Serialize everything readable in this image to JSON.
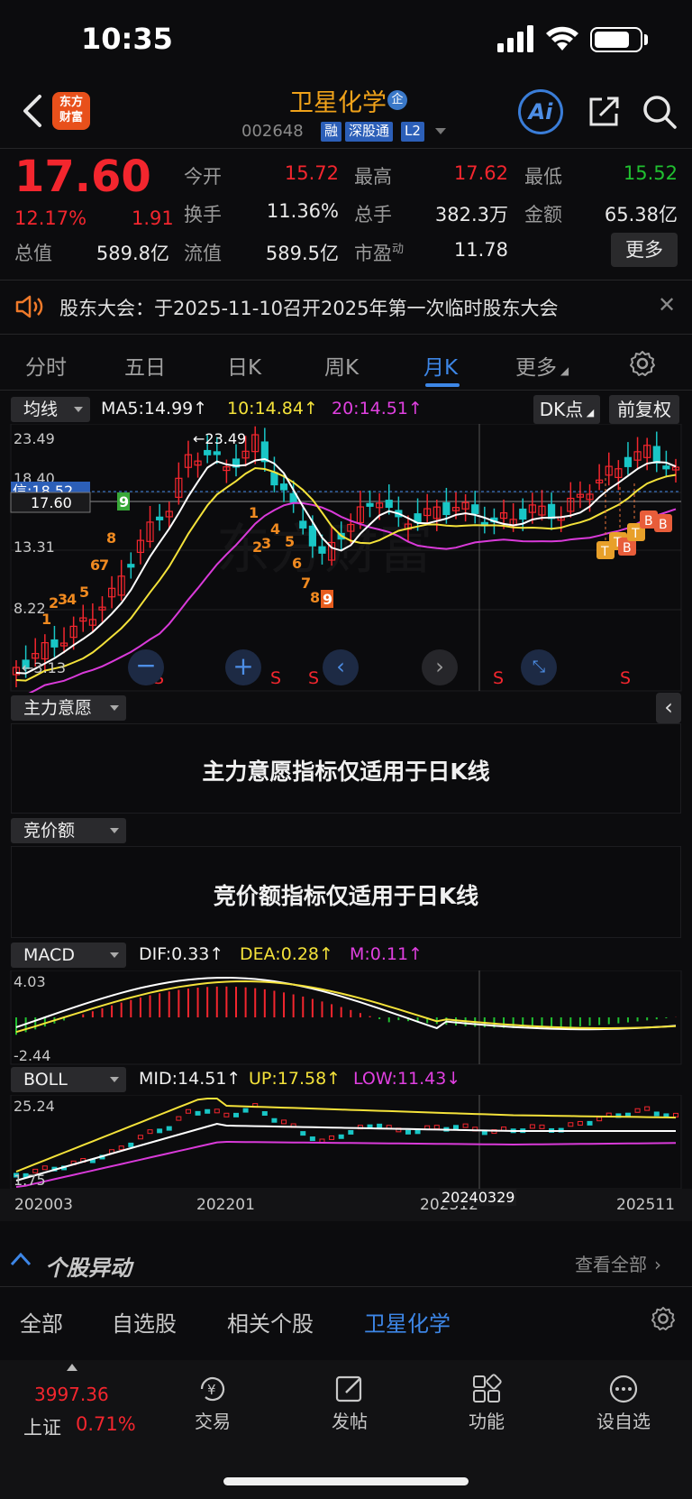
{
  "status": {
    "time": "10:35"
  },
  "header": {
    "logo_line1": "东方",
    "logo_line2": "财富",
    "stock_name": "卫星化学",
    "name_badge": "企",
    "code": "002648",
    "tags": [
      "融",
      "深股通",
      "L2"
    ],
    "ai_label": "Ai"
  },
  "quote": {
    "price": "17.60",
    "change_pct": "12.17%",
    "change_amt": "1.91",
    "rows": [
      [
        {
          "label": "今开",
          "value": "15.72",
          "color": "red"
        },
        {
          "label": "最高",
          "value": "17.62",
          "color": "red"
        },
        {
          "label": "最低",
          "value": "15.52",
          "color": "green"
        }
      ],
      [
        {
          "label": "换手",
          "value": "11.36%",
          "color": ""
        },
        {
          "label": "总手",
          "value": "382.3万",
          "color": ""
        },
        {
          "label": "金额",
          "value": "65.38亿",
          "color": ""
        }
      ]
    ],
    "row3": [
      {
        "label": "总值",
        "value": "589.8亿"
      },
      {
        "label": "流值",
        "value": "589.5亿"
      },
      {
        "label": "市盈",
        "sup": "动",
        "value": "11.78"
      }
    ],
    "more_label": "更多"
  },
  "notice": {
    "text": "股东大会：于2025-11-10召开2025年第一次临时股东大会"
  },
  "tabs": {
    "items": [
      "分时",
      "五日",
      "日K",
      "周K",
      "月K",
      "更多"
    ],
    "active": "月K"
  },
  "main_chart": {
    "indicator_select": "均线",
    "ma5": "MA5:14.99↑",
    "ma10": "10:14.84↑",
    "ma20": "20:14.51↑",
    "dk_label": "DK点",
    "fq_label": "前复权",
    "y_labels": [
      "23.49",
      "18.40",
      "13.31",
      "8.22",
      "3.13"
    ],
    "max_label": "←23.49",
    "min_label": "←3.13",
    "current_price_tag": "17.60",
    "left_tag": "信:18.52",
    "sell_marks": [
      "S",
      "S",
      "S",
      "S",
      "S"
    ]
  },
  "panel_zhuli": {
    "select": "主力意愿",
    "message": "主力意愿指标仅适用于日K线"
  },
  "panel_jingjia": {
    "select": "竞价额",
    "message": "竞价额指标仅适用于日K线"
  },
  "macd": {
    "select": "MACD",
    "dif": "DIF:0.33↑",
    "dea": "DEA:0.28↑",
    "m": "M:0.11↑",
    "y_top": "4.03",
    "y_bottom": "-2.44"
  },
  "boll": {
    "select": "BOLL",
    "mid": "MID:14.51↑",
    "up": "UP:17.58↑",
    "low": "LOW:11.43↓",
    "y_top": "25.24",
    "y_bottom": "1.75"
  },
  "x_dates": [
    "202003",
    "202201",
    "202312",
    "20240329",
    "202511"
  ],
  "abnormal": {
    "title": "个股异动",
    "view_all": "查看全部",
    "tabs": [
      "全部",
      "自选股",
      "相关个股",
      "卫星化学"
    ],
    "active": "卫星化学"
  },
  "bottom_nav": {
    "index_value": "3997.36",
    "index_name": "上证",
    "index_pct": "0.71%",
    "items": [
      "交易",
      "发帖",
      "功能",
      "设自选"
    ]
  },
  "colors": {
    "up": "#f3262e",
    "down": "#20c030",
    "accent": "#3d86e6",
    "brand": "#f0a21a"
  }
}
